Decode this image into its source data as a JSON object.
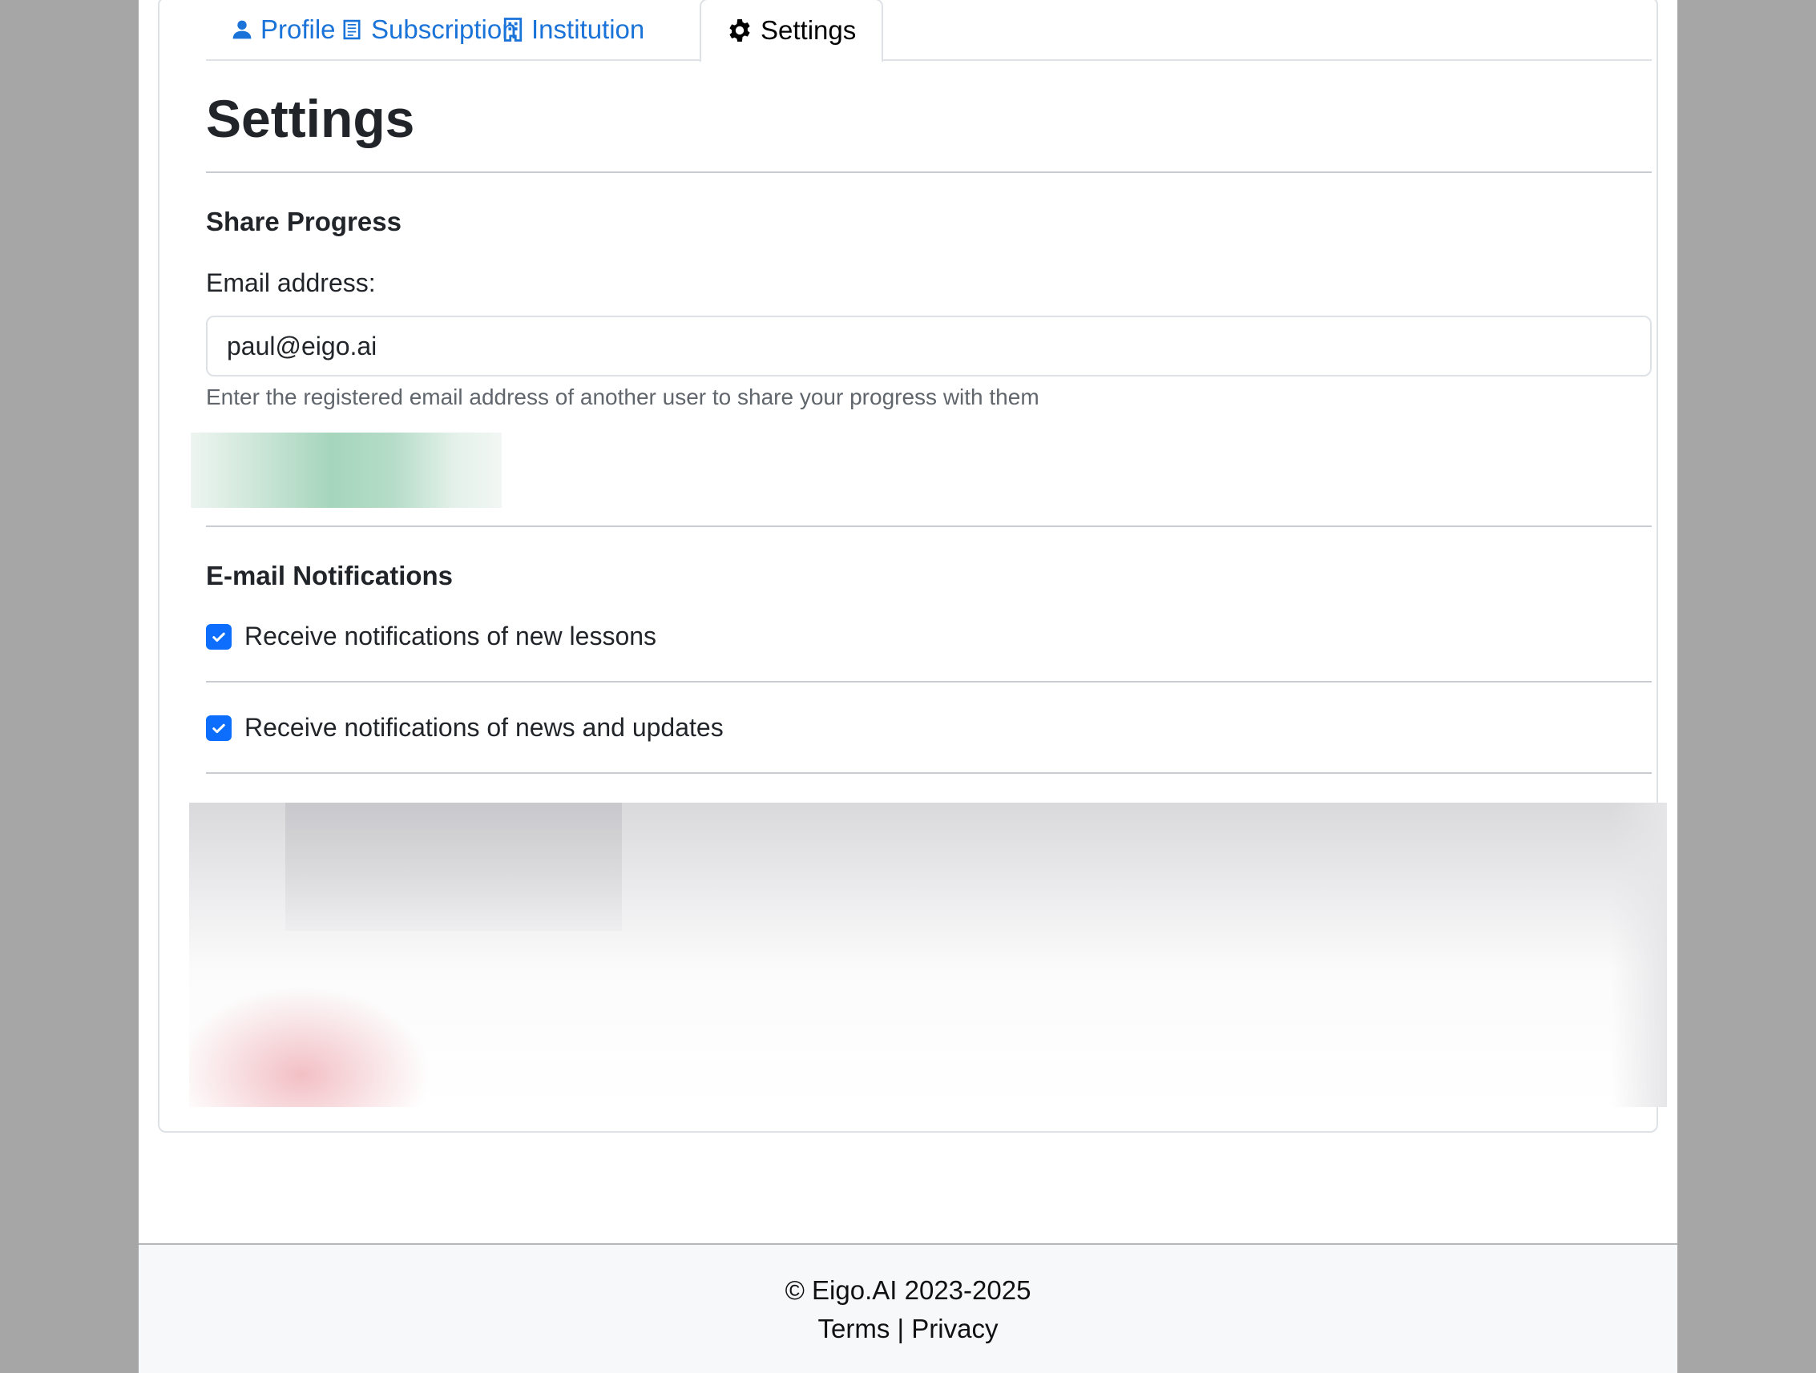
{
  "tabs": [
    {
      "label": "Profile",
      "icon": "person-icon"
    },
    {
      "label": "Subscription",
      "icon": "receipt-icon"
    },
    {
      "label": "Institution",
      "icon": "building-icon"
    },
    {
      "label": "Settings",
      "icon": "gear-icon",
      "active": true
    }
  ],
  "page": {
    "title": "Settings"
  },
  "share_progress": {
    "title": "Share Progress",
    "email_label": "Email address:",
    "email_value": "paul@eigo.ai",
    "help_text": "Enter the registered email address of another user to share your progress with them"
  },
  "notifications": {
    "title": "E-mail Notifications",
    "items": [
      {
        "label": "Receive notifications of new lessons",
        "checked": true
      },
      {
        "label": "Receive notifications of news and updates",
        "checked": true
      }
    ]
  },
  "footer": {
    "copyright": "© Eigo.AI 2023-2025",
    "terms": "Terms",
    "separator": "|",
    "privacy": "Privacy"
  },
  "colors": {
    "link": "#1a73d9",
    "checkbox": "#0d6efd",
    "background": "#a6a6a6"
  }
}
